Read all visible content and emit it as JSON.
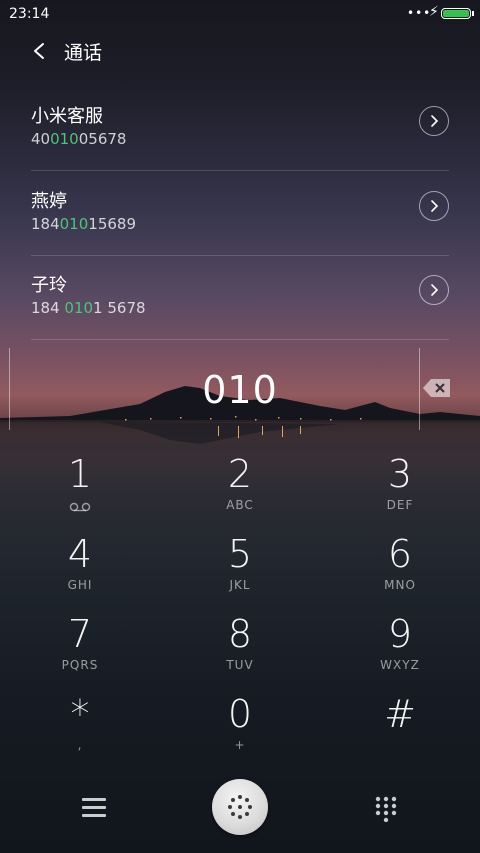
{
  "status_bar": {
    "time": "23:14",
    "signal_dots": "•••"
  },
  "header": {
    "title": "通话"
  },
  "contacts": [
    {
      "name": "小米客服",
      "number_pre": "40",
      "number_match": "010",
      "number_post": "05678"
    },
    {
      "name": "燕婷",
      "number_pre": "184",
      "number_match": "010",
      "number_post": "15689"
    },
    {
      "name": "子玲",
      "number_pre": "184 ",
      "number_match": "010",
      "number_post": "1 5678"
    }
  ],
  "dial_input": {
    "value": "010"
  },
  "keypad": [
    {
      "digit": "1",
      "letters": ""
    },
    {
      "digit": "2",
      "letters": "ABC"
    },
    {
      "digit": "3",
      "letters": "DEF"
    },
    {
      "digit": "4",
      "letters": "GHI"
    },
    {
      "digit": "5",
      "letters": "JKL"
    },
    {
      "digit": "6",
      "letters": "MNO"
    },
    {
      "digit": "7",
      "letters": "PQRS"
    },
    {
      "digit": "8",
      "letters": "TUV"
    },
    {
      "digit": "9",
      "letters": "WXYZ"
    },
    {
      "digit": "*",
      "letters": ","
    },
    {
      "digit": "0",
      "letters": "+"
    },
    {
      "digit": "#",
      "letters": ""
    }
  ],
  "colors": {
    "match_highlight": "#4fc37a",
    "battery": "#35c14d"
  }
}
